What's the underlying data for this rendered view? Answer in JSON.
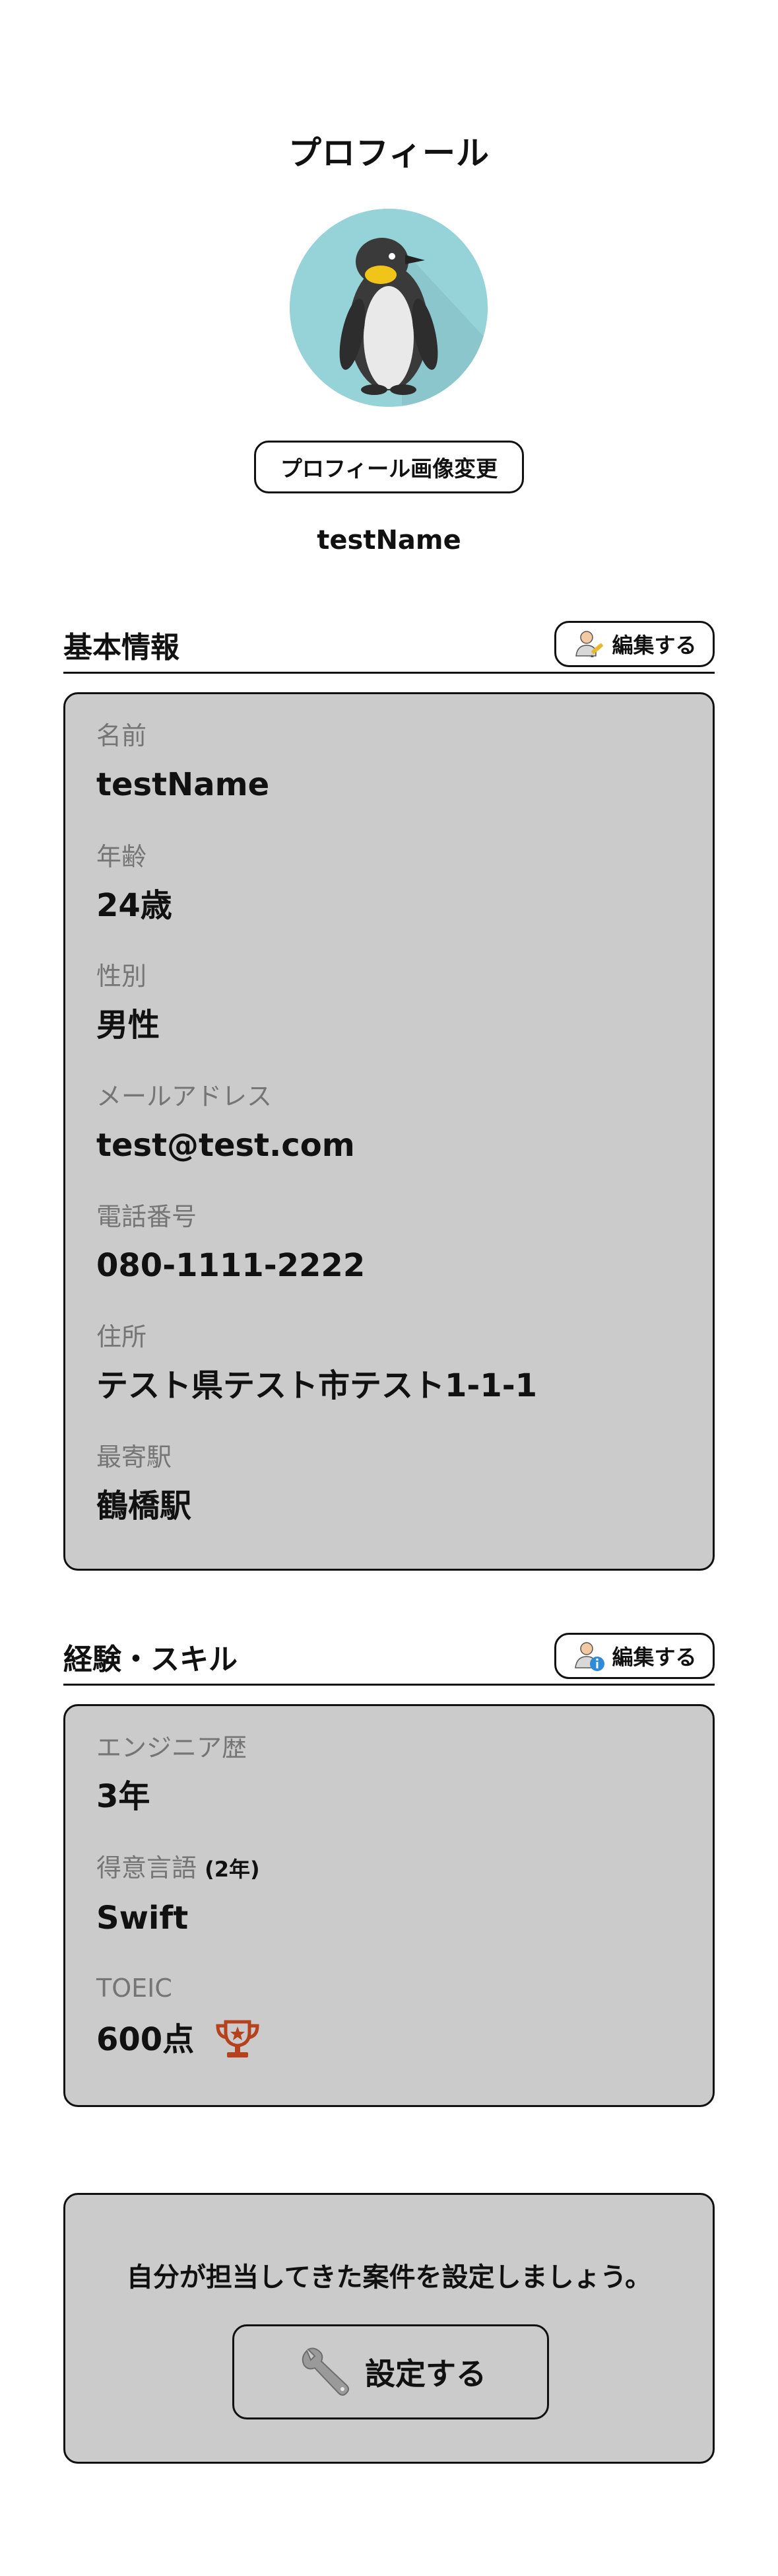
{
  "header": {
    "title": "プロフィール"
  },
  "profile": {
    "change_photo_label": "プロフィール画像変更",
    "display_name": "testName"
  },
  "basic_info": {
    "title": "基本情報",
    "edit_label": "編集する",
    "fields": [
      {
        "label": "名前",
        "value": "testName"
      },
      {
        "label": "年齢",
        "value": "24歳"
      },
      {
        "label": "性別",
        "value": "男性"
      },
      {
        "label": "メールアドレス",
        "value": "test@test.com"
      },
      {
        "label": "電話番号",
        "value": "080-1111-2222"
      },
      {
        "label": "住所",
        "value": "テスト県テスト市テスト1-1-1"
      },
      {
        "label": "最寄駅",
        "value": "鶴橋駅"
      }
    ]
  },
  "skills": {
    "title": "経験・スキル",
    "edit_label": "編集する",
    "engineer_years": {
      "label": "エンジニア歴",
      "value": "3年"
    },
    "language": {
      "label": "得意言語",
      "sub": "(2年)",
      "value": "Swift"
    },
    "toeic": {
      "label": "TOEIC",
      "value": "600点",
      "icon": "trophy-icon"
    }
  },
  "projects_cta": {
    "message": "自分が担当してきた案件を設定しましょう。",
    "button_label": "設定する",
    "button_icon": "wrench-icon"
  },
  "colors": {
    "card_bg": "#cbcbcb",
    "avatar_bg": "#96d3d8",
    "label_gray": "#757575",
    "trophy": "#b5421d"
  }
}
